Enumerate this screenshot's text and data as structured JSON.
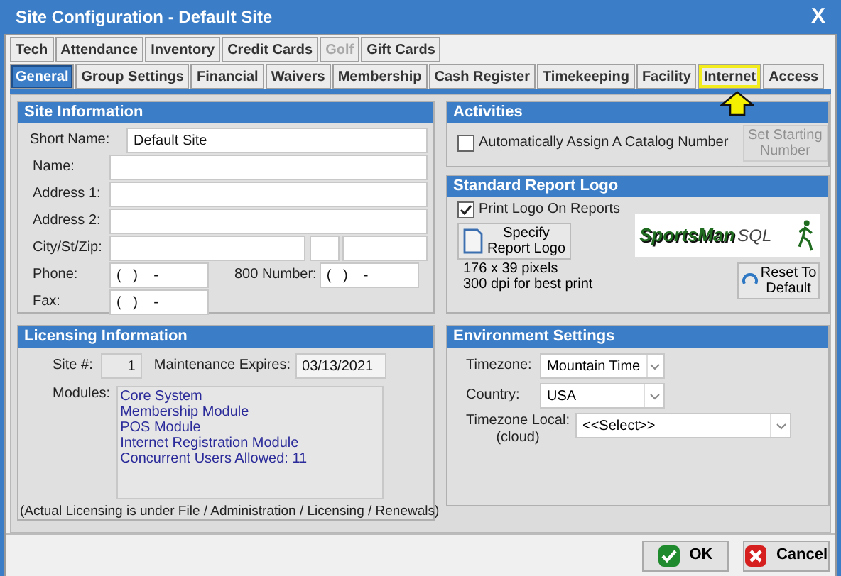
{
  "window": {
    "title": "Site Configuration - Default Site",
    "close": "X"
  },
  "tab_rows": [
    [
      {
        "label": "Tech",
        "selected": false,
        "disabled": false,
        "highlighted": false
      },
      {
        "label": "Attendance",
        "selected": false,
        "disabled": false,
        "highlighted": false
      },
      {
        "label": "Inventory",
        "selected": false,
        "disabled": false,
        "highlighted": false
      },
      {
        "label": "Credit Cards",
        "selected": false,
        "disabled": false,
        "highlighted": false
      },
      {
        "label": "Golf",
        "selected": false,
        "disabled": true,
        "highlighted": false
      },
      {
        "label": "Gift Cards",
        "selected": false,
        "disabled": false,
        "highlighted": false
      }
    ],
    [
      {
        "label": "General",
        "selected": true,
        "disabled": false,
        "highlighted": false
      },
      {
        "label": "Group Settings",
        "selected": false,
        "disabled": false,
        "highlighted": false
      },
      {
        "label": "Financial",
        "selected": false,
        "disabled": false,
        "highlighted": false
      },
      {
        "label": "Waivers",
        "selected": false,
        "disabled": false,
        "highlighted": false
      },
      {
        "label": "Membership",
        "selected": false,
        "disabled": false,
        "highlighted": false
      },
      {
        "label": "Cash Register",
        "selected": false,
        "disabled": false,
        "highlighted": false
      },
      {
        "label": "Timekeeping",
        "selected": false,
        "disabled": false,
        "highlighted": false
      },
      {
        "label": "Facility",
        "selected": false,
        "disabled": false,
        "highlighted": false
      },
      {
        "label": "Internet",
        "selected": false,
        "disabled": false,
        "highlighted": true
      },
      {
        "label": "Access",
        "selected": false,
        "disabled": false,
        "highlighted": false
      }
    ]
  ],
  "site_information": {
    "title": "Site Information",
    "short_name": {
      "label": "Short Name:",
      "value": "Default Site"
    },
    "name": {
      "label": "Name:"
    },
    "address_1": {
      "label": "Address 1:"
    },
    "address_2": {
      "label": "Address 2:"
    },
    "city_st_zip": {
      "label": "City/St/Zip:"
    },
    "phone": {
      "label": "Phone:",
      "value": "(   )    -"
    },
    "number_800": {
      "label": "800 Number:",
      "value": "(   )    -"
    },
    "fax": {
      "label": "Fax:",
      "value": "(   )    -"
    }
  },
  "licensing": {
    "title": "Licensing Information",
    "site_no": {
      "label": "Site #:",
      "value": "1"
    },
    "maintenance": {
      "label": "Maintenance Expires:",
      "value": "03/13/2021"
    },
    "modules_label": "Modules:",
    "modules": [
      "Core System",
      "Membership Module",
      "POS Module",
      "Internet Registration Module",
      "Concurrent Users Allowed: 11"
    ],
    "note": "(Actual Licensing is under File / Administration / Licensing / Renewals)"
  },
  "activities": {
    "title": "Activities",
    "checkbox": {
      "label": "Automatically Assign A Catalog Number",
      "checked": false
    },
    "button": {
      "label": "Set Starting Number",
      "disabled": true
    }
  },
  "report_logo": {
    "title": "Standard Report Logo",
    "checkbox": {
      "label": "Print Logo On Reports",
      "checked": true
    },
    "specify_button": "Specify Report Logo",
    "size_info": [
      "176 x 39 pixels",
      "300 dpi for best print"
    ],
    "logo": {
      "brand": "SportsMan",
      "suffix": "SQL"
    },
    "reset_button": "Reset To Default"
  },
  "environment": {
    "title": "Environment Settings",
    "timezone": {
      "label": "Timezone:",
      "value": "Mountain Time"
    },
    "country": {
      "label": "Country:",
      "value": "USA"
    },
    "timezone_local": {
      "label": "Timezone Local:",
      "sublabel": "(cloud)",
      "value": "<<Select>>"
    }
  },
  "buttons": [
    {
      "kind": "ok",
      "label": "OK"
    },
    {
      "kind": "cancel",
      "label": "Cancel"
    }
  ]
}
